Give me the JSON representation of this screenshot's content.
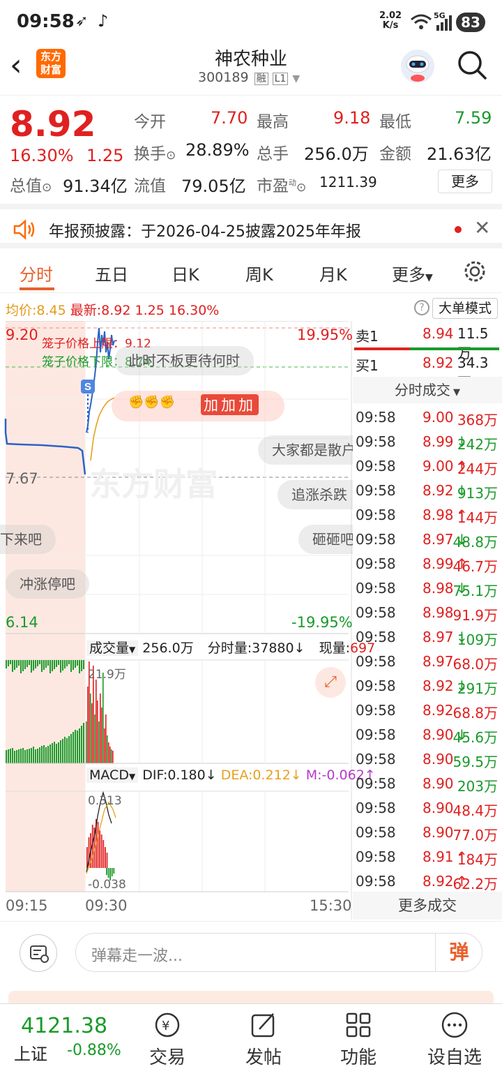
{
  "status": {
    "time": "09:58",
    "speed_val": "2.02",
    "speed_unit": "K/s",
    "net": "5G",
    "battery": "83"
  },
  "nav": {
    "brand_line1": "东方",
    "brand_line2": "财富",
    "stock_name": "神农种业",
    "stock_code": "300189",
    "tag1": "融",
    "tag2": "L1"
  },
  "quote": {
    "price": "8.92",
    "pct": "16.30%",
    "change": "1.25",
    "open_label": "今开",
    "open": "7.70",
    "high_label": "最高",
    "high": "9.18",
    "low_label": "最低",
    "low": "7.59",
    "turnover_label": "换手",
    "turnover": "28.89%",
    "volume_label": "总手",
    "volume": "256.0万",
    "amount_label": "金额",
    "amount": "21.63亿",
    "mcap_label": "总值",
    "mcap": "91.34亿",
    "float_label": "流值",
    "float": "79.05亿",
    "pe_label": "市盈",
    "pe_sup": "动",
    "pe": "1211.39",
    "more": "更多"
  },
  "notice": {
    "text": "年报预披露：于2026-04-25披露2025年年报"
  },
  "tabs": [
    "分时",
    "五日",
    "日K",
    "周K",
    "月K",
    "更多"
  ],
  "chart": {
    "avg_label": "均价:",
    "avg": "8.45",
    "latest_label": "最新:",
    "latest": "8.92",
    "latest_chg": "1.25",
    "latest_pct": "16.30%",
    "mode_btn": "大单模式",
    "top_price": "9.20",
    "top_pct": "19.95%",
    "mid_price": "7.67",
    "bottom_price": "6.14",
    "bottom_pct": "-19.95%",
    "cage_upper": "笼子价格上限：9.12",
    "cage_lower": "笼子价格下限：8.74",
    "danmaku": [
      "此时不板更待何时",
      "大家都是散户",
      "追涨杀跌",
      "下来吧",
      "砸砸吧",
      "冲涨停吧"
    ],
    "cheer": "加加加",
    "vol_label": "成交量",
    "vol_total": "256.0万",
    "vol_minute": "分时量:37880↓",
    "vol_now_label": "现量:",
    "vol_now": "697",
    "vol_peak": "21.9万",
    "macd_label": "MACD",
    "dif": "DIF:0.180↓",
    "dea": "DEA:0.212↓",
    "m": "M:-0.062↑",
    "macd_top": "0.313",
    "macd_bottom": "-0.038",
    "t_start": "09:15",
    "t_mid": "09:30",
    "t_end": "15:30"
  },
  "orderbook": {
    "sell1_label": "卖1",
    "sell1_price": "8.94",
    "sell1_vol": "11.5万",
    "buy1_label": "买1",
    "buy1_price": "8.92",
    "buy1_vol": "34.3万",
    "ticks_title": "分时成交",
    "ticks": [
      {
        "t": "09:58",
        "p": "9.00",
        "a": "",
        "v": "368万",
        "c": "red"
      },
      {
        "t": "09:58",
        "p": "8.99",
        "a": "↓",
        "v": "242万",
        "c": "green"
      },
      {
        "t": "09:58",
        "p": "9.00",
        "a": "↑",
        "v": "244万",
        "c": "red"
      },
      {
        "t": "09:58",
        "p": "8.92",
        "a": "↓",
        "v": "913万",
        "c": "green"
      },
      {
        "t": "09:58",
        "p": "8.98",
        "a": "↑",
        "v": "144万",
        "c": "red"
      },
      {
        "t": "09:58",
        "p": "8.97",
        "a": "↓",
        "v": "48.8万",
        "c": "green"
      },
      {
        "t": "09:58",
        "p": "8.99",
        "a": "↑",
        "v": "46.7万",
        "c": "red"
      },
      {
        "t": "09:58",
        "p": "8.98",
        "a": "↓",
        "v": "75.1万",
        "c": "green"
      },
      {
        "t": "09:58",
        "p": "8.98",
        "a": "",
        "v": "91.9万",
        "c": "red"
      },
      {
        "t": "09:58",
        "p": "8.97",
        "a": "↓",
        "v": "109万",
        "c": "green"
      },
      {
        "t": "09:58",
        "p": "8.97",
        "a": "",
        "v": "68.0万",
        "c": "red"
      },
      {
        "t": "09:58",
        "p": "8.92",
        "a": "↓",
        "v": "291万",
        "c": "green"
      },
      {
        "t": "09:58",
        "p": "8.92",
        "a": "",
        "v": "68.8万",
        "c": "red"
      },
      {
        "t": "09:58",
        "p": "8.90",
        "a": "↓",
        "v": "45.6万",
        "c": "green"
      },
      {
        "t": "09:58",
        "p": "8.90",
        "a": "",
        "v": "59.5万",
        "c": "green"
      },
      {
        "t": "09:58",
        "p": "8.90",
        "a": "",
        "v": "203万",
        "c": "green"
      },
      {
        "t": "09:58",
        "p": "8.90",
        "a": "",
        "v": "48.4万",
        "c": "red"
      },
      {
        "t": "09:58",
        "p": "8.90",
        "a": "",
        "v": "77.0万",
        "c": "red"
      },
      {
        "t": "09:58",
        "p": "8.91",
        "a": "↑",
        "v": "184万",
        "c": "red"
      },
      {
        "t": "09:58",
        "p": "8.92",
        "a": "↑",
        "v": "62.2万",
        "c": "red"
      }
    ],
    "more": "更多成交"
  },
  "input": {
    "placeholder": "弹幕走一波...",
    "danmaku_btn": "弹"
  },
  "tabbar": {
    "index_val": "4121.38",
    "index_name": "上证",
    "index_pct": "-0.88%",
    "items": [
      "交易",
      "发帖",
      "功能",
      "设自选"
    ]
  },
  "colors": {
    "red": "#e02020",
    "green": "#1a9a2a",
    "brand": "#ff6a00"
  }
}
